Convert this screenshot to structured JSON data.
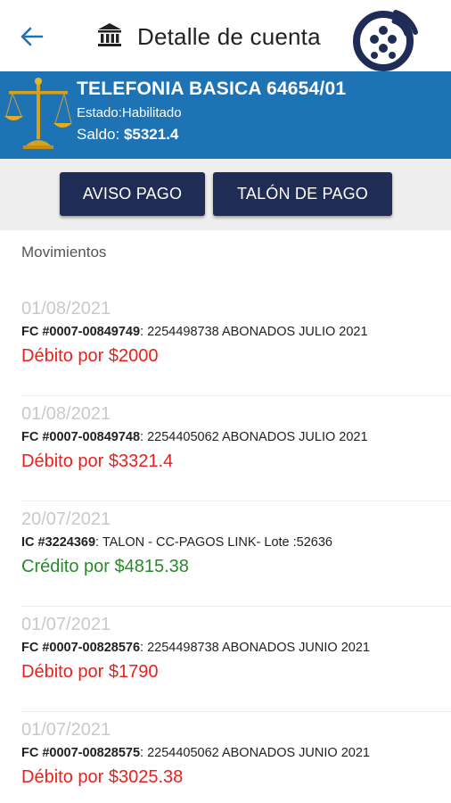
{
  "header": {
    "title": "Detalle de cuenta"
  },
  "account": {
    "name": "TELEFONIA BASICA 64654/01",
    "status": "Estado:Habilitado",
    "balance_label": "Saldo:",
    "balance_value": "$5321.4"
  },
  "actions": {
    "aviso_label": "AVISO PAGO",
    "talon_label": "TALÓN DE PAGO"
  },
  "movements": {
    "heading": "Movimientos",
    "items": [
      {
        "date": "01/08/2021",
        "ref": "FC #0007-00849749",
        "desc": ": 2254498738 ABONADOS JULIO 2021",
        "amount": "Débito por $2000",
        "type": "debit"
      },
      {
        "date": "01/08/2021",
        "ref": "FC #0007-00849748",
        "desc": ": 2254405062 ABONADOS JULIO 2021",
        "amount": "Débito por $3321.4",
        "type": "debit"
      },
      {
        "date": "20/07/2021",
        "ref": "IC #3224369",
        "desc": ": TALON - CC-PAGOS LINK- Lote :52636",
        "amount": "Crédito por $4815.38",
        "type": "credit"
      },
      {
        "date": "01/07/2021",
        "ref": "FC #0007-00828576",
        "desc": ": 2254498738 ABONADOS JUNIO 2021",
        "amount": "Débito por $1790",
        "type": "debit"
      },
      {
        "date": "01/07/2021",
        "ref": "FC #0007-00828575",
        "desc": ": 2254405062 ABONADOS JUNIO 2021",
        "amount": "Débito por $3025.38",
        "type": "debit"
      }
    ]
  },
  "colors": {
    "primary_blue": "#1e73b4",
    "button_navy": "#1f2d56",
    "debit_red": "#e8211d",
    "credit_green": "#2a8a2a"
  }
}
